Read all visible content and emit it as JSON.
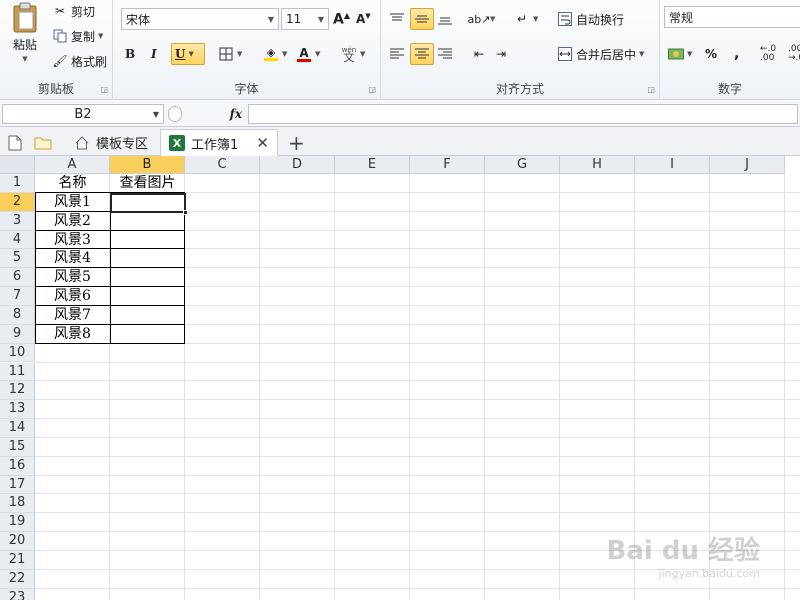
{
  "ribbon": {
    "clipboard": {
      "paste_label": "粘贴",
      "cut_label": "剪切",
      "copy_label": "复制",
      "format_painter_label": "格式刷",
      "group_label": "剪贴板"
    },
    "font": {
      "font_name": "宋体",
      "font_size": "11",
      "group_label": "字体",
      "bold": "B",
      "italic": "I",
      "underline": "U",
      "phonetic": "wén"
    },
    "alignment": {
      "wrap_text_label": "自动换行",
      "merge_center_label": "合并后居中",
      "group_label": "对齐方式"
    },
    "number": {
      "format": "常规",
      "percent": "%",
      "comma": ",",
      "group_label": "数字"
    }
  },
  "formula_bar": {
    "name_box": "B2",
    "fx": "fx",
    "formula": ""
  },
  "tabs": {
    "template_tab": "模板专区",
    "workbook_tab": "工作簿1"
  },
  "sheet": {
    "columns": [
      "A",
      "B",
      "C",
      "D",
      "E",
      "F",
      "G",
      "H",
      "I",
      "J"
    ],
    "rows": [
      "1",
      "2",
      "3",
      "4",
      "5",
      "6",
      "7",
      "8",
      "9",
      "10",
      "11",
      "12",
      "13",
      "14",
      "15",
      "16",
      "17",
      "18",
      "19",
      "20",
      "21",
      "22",
      "23"
    ],
    "header_row": {
      "A": "名称",
      "B": "查看图片"
    },
    "names": [
      "风景1",
      "风景2",
      "风景3",
      "风景4",
      "风景5",
      "风景6",
      "风景7",
      "风景8"
    ],
    "selected_cell": "B2"
  },
  "watermark": {
    "brand": "Bai du 经验",
    "url": "jingyan.baidu.com"
  },
  "colors": {
    "selection": "#f8cf5a",
    "excel_green": "#1d7a3a",
    "table_border": "#000000"
  }
}
